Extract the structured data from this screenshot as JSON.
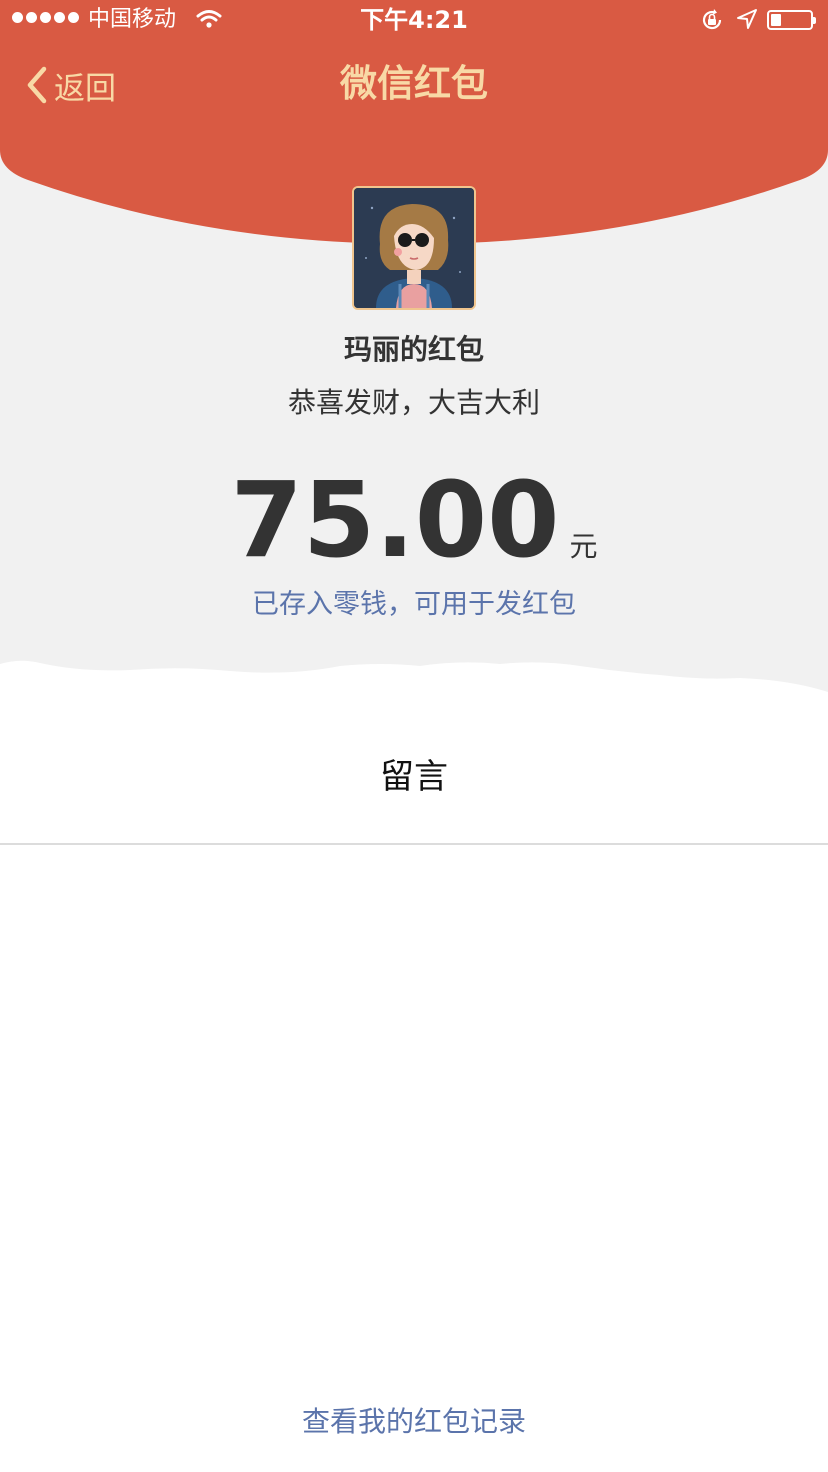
{
  "status_bar": {
    "carrier": "中国移动",
    "time": "下午4:21",
    "icons": [
      "signal-icon",
      "wifi-icon",
      "rotation-lock-icon",
      "location-icon",
      "battery-icon"
    ]
  },
  "nav": {
    "back_label": "返回",
    "title": "微信红包"
  },
  "envelope": {
    "sender_title": "玛丽的红包",
    "greeting": "恭喜发财，大吉大利",
    "amount": "75.00",
    "unit": "元",
    "deposit_note": "已存入零钱，可用于发红包"
  },
  "message": {
    "heading": "留言"
  },
  "footer": {
    "history_link": "查看我的红包记录"
  },
  "colors": {
    "header_red": "#d95a43",
    "header_text": "#f8d9a6",
    "link_blue": "#5b74ab",
    "background_grey": "#f1f1f1"
  }
}
